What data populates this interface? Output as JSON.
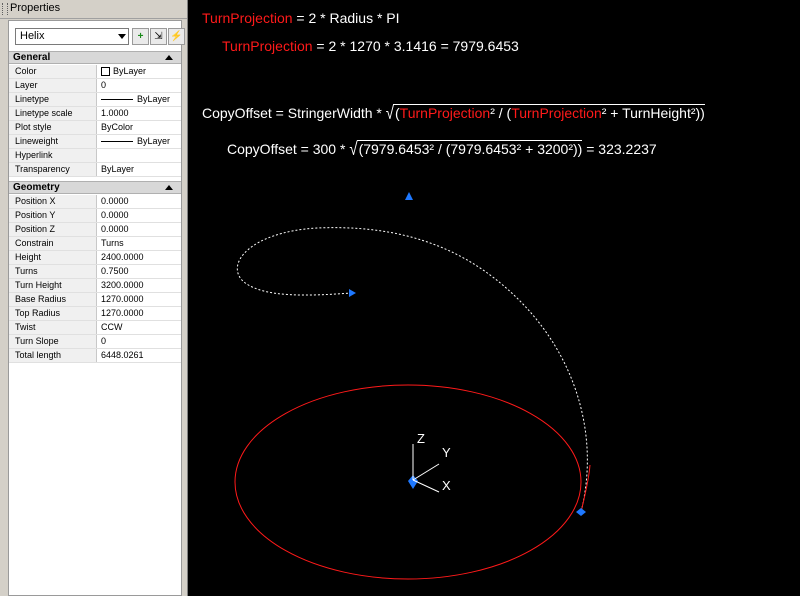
{
  "palette": {
    "title": "Properties",
    "object_type": "Helix",
    "buttons": {
      "toggle_pickadd": "+",
      "select_objects": "⇲",
      "quick_select": "⚡"
    },
    "general": {
      "header": "General",
      "rows": [
        {
          "label": "Color",
          "value": "ByLayer"
        },
        {
          "label": "Layer",
          "value": "0"
        },
        {
          "label": "Linetype",
          "value": "ByLayer"
        },
        {
          "label": "Linetype scale",
          "value": "1.0000"
        },
        {
          "label": "Plot style",
          "value": "ByColor"
        },
        {
          "label": "Lineweight",
          "value": "ByLayer"
        },
        {
          "label": "Hyperlink",
          "value": ""
        },
        {
          "label": "Transparency",
          "value": "ByLayer"
        }
      ]
    },
    "geometry": {
      "header": "Geometry",
      "rows": [
        {
          "label": "Position X",
          "value": "0.0000"
        },
        {
          "label": "Position Y",
          "value": "0.0000"
        },
        {
          "label": "Position Z",
          "value": "0.0000"
        },
        {
          "label": "Constrain",
          "value": "Turns"
        },
        {
          "label": "Height",
          "value": "2400.0000"
        },
        {
          "label": "Turns",
          "value": "0.7500"
        },
        {
          "label": "Turn Height",
          "value": "3200.0000"
        },
        {
          "label": "Base Radius",
          "value": "1270.0000"
        },
        {
          "label": "Top Radius",
          "value": "1270.0000"
        },
        {
          "label": "Twist",
          "value": "CCW"
        },
        {
          "label": "Turn Slope",
          "value": "0"
        },
        {
          "label": "Total length",
          "value": "6448.0261"
        }
      ]
    }
  },
  "drawing": {
    "formula1": {
      "name": "TurnProjection",
      "rhs": "=  2 * Radius * PI"
    },
    "formula2": {
      "name": "TurnProjection",
      "rhs": "=  2 * 1270 * 3.1416 = 7979.6453"
    },
    "formula3": {
      "lhs": "CopyOffset =  StringerWidth  * ",
      "open": "(",
      "tp1": "TurnProjection",
      "mid": "² / (",
      "tp2": "TurnProjection",
      "tail": "² + TurnHeight²))"
    },
    "formula4": {
      "lhs": "CopyOffset = 300 * ",
      "inner": "(7979.6453² / (7979.6453² + 3200²))",
      "result": " = 323.2237"
    },
    "ucs": {
      "x": "X",
      "y": "Y",
      "z": "Z"
    },
    "colors": {
      "base_circle": "#ff1a1a",
      "helix": "#ffffff",
      "grip": "#1e78ff"
    }
  }
}
